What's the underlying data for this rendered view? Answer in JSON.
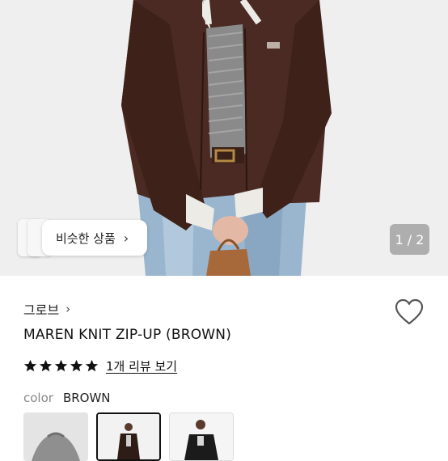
{
  "image_pager": {
    "text": "1 / 2"
  },
  "similar": {
    "label": "비슷한 상품",
    "chevron": "›"
  },
  "product": {
    "brand": "그로브",
    "brand_chevron": "›",
    "title": "MAREN KNIT ZIP-UP (BROWN)",
    "rating_stars": 5,
    "review_link": "1개 리뷰 보기",
    "color_label": "color",
    "color_value": "BROWN",
    "swatches": [
      "grey-knit-swatch",
      "brown-zipup-swatch",
      "black-zipup-swatch"
    ]
  },
  "icons": {
    "heart": "heart-outline-icon",
    "star": "star-filled-icon"
  },
  "colors": {
    "star": "#111111",
    "accent_border": "#111111",
    "pager_bg": "#7a7a7a"
  }
}
